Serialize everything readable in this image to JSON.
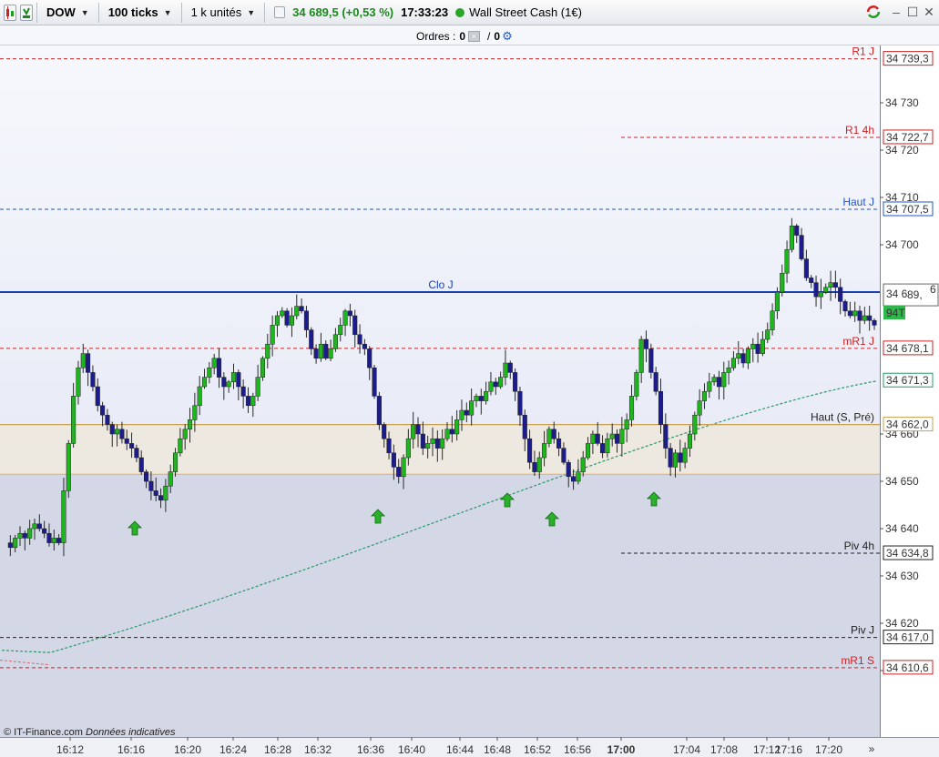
{
  "toolbar": {
    "instrument": "DOW",
    "interval": "100 ticks",
    "units": "1 k unités",
    "price": "34 689,5 (+0,53 %)",
    "time": "17:33:23",
    "market": "Wall Street Cash (1€)"
  },
  "orders": {
    "label": "Ordres :",
    "count_a": "0",
    "count_b": "0"
  },
  "footer": {
    "source": "© IT-Finance.com",
    "note": "Données indicatives"
  },
  "colors": {
    "up": "#1fb51f",
    "down": "#1c1c8c",
    "support": "#cc2222",
    "resistance": "#2255cc",
    "close_line": "#1a3fb0",
    "ma": "#2a9a6a"
  },
  "chart_data": {
    "type": "candlestick",
    "ylim": [
      34600,
      34750
    ],
    "x_ticks": [
      "16:12",
      "16:16",
      "16:20",
      "16:24",
      "16:28",
      "16:32",
      "16:36",
      "16:40",
      "16:44",
      "16:48",
      "16:52",
      "16:56",
      "17:00",
      "17:04",
      "17:08",
      "17:12",
      "17:16",
      "17:20"
    ],
    "y_ticks": [
      {
        "label": "34 730",
        "value": 34730
      },
      {
        "label": "34 720",
        "value": 34720
      },
      {
        "label": "34 710",
        "value": 34710
      },
      {
        "label": "34 700",
        "value": 34700
      },
      {
        "label": "34 660",
        "value": 34660
      },
      {
        "label": "34 650",
        "value": 34650
      },
      {
        "label": "34 640",
        "value": 34640
      },
      {
        "label": "34 630",
        "value": 34630
      },
      {
        "label": "34 620",
        "value": 34620
      },
      {
        "label": "34 610",
        "value": 34610
      }
    ],
    "levels": [
      {
        "name": "R1 J",
        "value": 34739.3,
        "label": "34 739,3",
        "color": "#cc2222",
        "style": "dash",
        "partial": false
      },
      {
        "name": "R1 4h",
        "value": 34722.7,
        "label": "34 722,7",
        "color": "#cc2222",
        "style": "dash",
        "partial": true
      },
      {
        "name": "Haut J",
        "value": 34707.5,
        "label": "34 707,5",
        "color": "#2255cc",
        "style": "dash",
        "partial": false
      },
      {
        "name": "Clo J",
        "value": 34690.0,
        "label": "34 690,0",
        "color": "#1a3fb0",
        "style": "solid",
        "partial": false
      },
      {
        "name": "mR1 J",
        "value": 34678.1,
        "label": "34 678,1",
        "color": "#cc2222",
        "style": "dash",
        "partial": false
      },
      {
        "name": "",
        "value": 34671.3,
        "label": "34 671,3",
        "color": "#2a9a6a",
        "style": "none",
        "partial": false
      },
      {
        "name": "Haut (S, Pré)",
        "value": 34662.0,
        "label": "34 662,0",
        "color": "#c8a050",
        "style": "solid",
        "partial": false
      },
      {
        "name": "Piv 4h",
        "value": 34634.8,
        "label": "34 634,8",
        "color": "#222222",
        "style": "dash",
        "partial": true
      },
      {
        "name": "Piv J",
        "value": 34617.0,
        "label": "34 617,0",
        "color": "#222222",
        "style": "dash",
        "partial": false
      },
      {
        "name": "mR1 S",
        "value": 34610.6,
        "label": "34 610,6",
        "color": "#cc2222",
        "style": "dash",
        "partial": false
      }
    ],
    "zone": {
      "from": 34651.5,
      "to": 34662.0
    },
    "current": {
      "prefix": "34 6",
      "big": "89,",
      "suffix": "6",
      "ticks": "94T",
      "value": 34689.6
    },
    "candle_path": [
      34637,
      34636,
      34638,
      34639,
      34638,
      34640,
      34641,
      34640,
      34639,
      34637,
      34638,
      34637,
      34648,
      34658,
      34668,
      34674,
      34677,
      34673,
      34670,
      34666,
      34664,
      34662,
      34660,
      34661,
      34659,
      34658,
      34657,
      34655,
      34652,
      34650,
      34648,
      34647,
      34646,
      34649,
      34652,
      34656,
      34659,
      34661,
      34663,
      34666,
      34670,
      34672,
      34674,
      34676,
      34672,
      34670,
      34671,
      34673,
      34670,
      34668,
      34666,
      34668,
      34672,
      34676,
      34679,
      34683,
      34685,
      34686,
      34683,
      34685,
      34687,
      34686,
      34682,
      34678,
      34676,
      34679,
      34676,
      34678,
      34681,
      34683,
      34686,
      34685,
      34681,
      34679,
      34678,
      34674,
      34668,
      34662,
      34659,
      34656,
      34653,
      34651,
      34655,
      34659,
      34662,
      34660,
      34657,
      34658,
      34659,
      34657,
      34659,
      34661,
      34660,
      34663,
      34665,
      34664,
      34667,
      34668,
      34667,
      34669,
      34671,
      34670,
      34672,
      34675,
      34673,
      34669,
      34664,
      34659,
      34654,
      34652,
      34655,
      34658,
      34661,
      34659,
      34657,
      34654,
      34651,
      34650,
      34652,
      34655,
      34658,
      34660,
      34658,
      34656,
      34659,
      34660,
      34658,
      34661,
      34663,
      34668,
      34673,
      34680,
      34678,
      34673,
      34669,
      34662,
      34657,
      34653,
      34656,
      34654,
      34657,
      34660,
      34664,
      34667,
      34669,
      34671,
      34672,
      34670,
      34673,
      34674,
      34676,
      34677,
      34675,
      34678,
      34679,
      34677,
      34680,
      34682,
      34686,
      34690,
      34694,
      34699,
      34704,
      34702,
      34697,
      34693,
      34692,
      34689,
      34690,
      34691,
      34692,
      34691,
      34688,
      34686,
      34685,
      34686,
      34684,
      34685,
      34684,
      34683
    ]
  }
}
